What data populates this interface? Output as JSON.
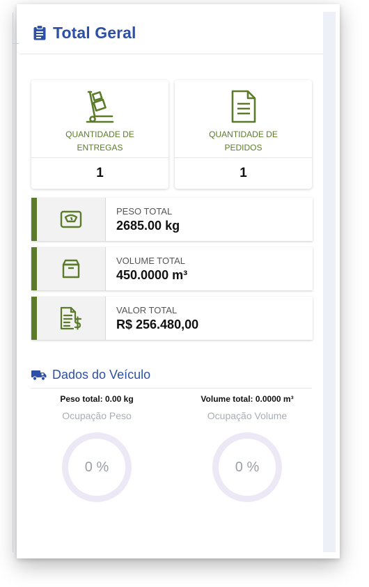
{
  "header": {
    "title": "Total Geral",
    "icon": "clipboard-icon"
  },
  "cards": [
    {
      "label": "QUANTIDADE DE ENTREGAS",
      "value": "1",
      "icon": "hand-truck-icon"
    },
    {
      "label": "QUANTIDADE DE PEDIDOS",
      "value": "1",
      "icon": "document-icon"
    }
  ],
  "metrics": [
    {
      "label": "PESO TOTAL",
      "value": "2685.00 kg",
      "icon": "scale-icon"
    },
    {
      "label": "VOLUME TOTAL",
      "value": "450.0000 m³",
      "icon": "box-icon"
    },
    {
      "label": "VALOR TOTAL",
      "value": "R$ 256.480,00",
      "icon": "invoice-dollar-icon"
    }
  ],
  "vehicle": {
    "title": "Dados do Veículo",
    "icon": "truck-icon",
    "weight": {
      "label": "Peso total: 0.00 kg",
      "subtitle": "Ocupação Peso",
      "percent": "0 %"
    },
    "volume": {
      "label": "Volume total: 0.0000 m³",
      "subtitle": "Ocupação Volume",
      "percent": "0 %"
    }
  },
  "colors": {
    "accent_blue": "#2d4fa6",
    "accent_green": "#5b7b2a",
    "ring": "#ece8f6"
  }
}
